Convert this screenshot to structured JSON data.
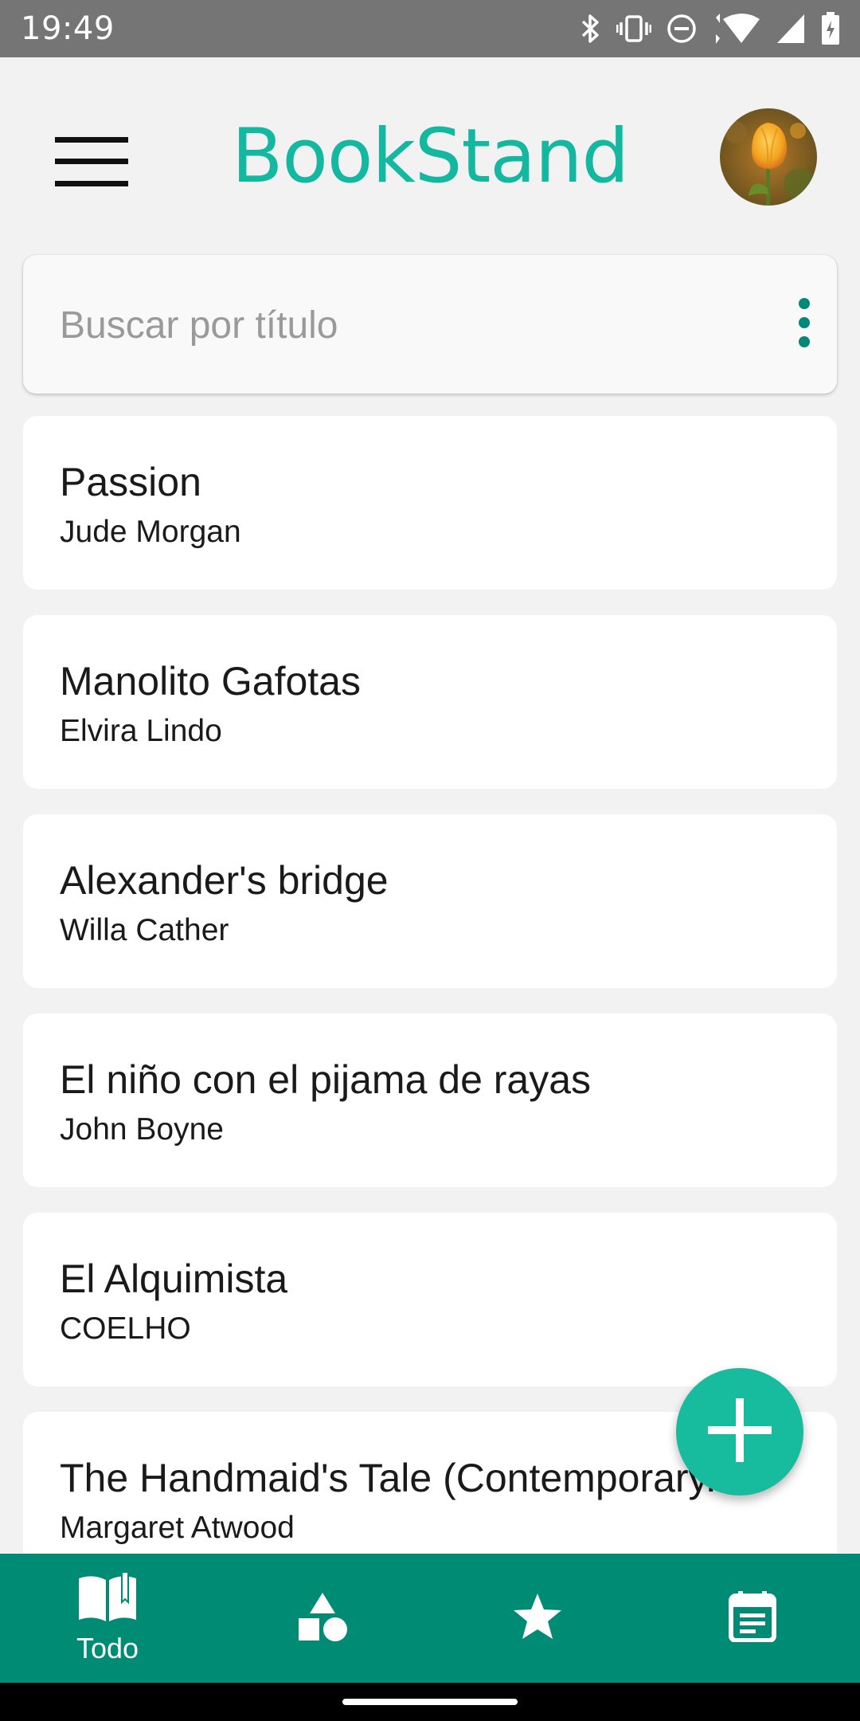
{
  "status_bar": {
    "time": "19:49",
    "icons": [
      "bluetooth-icon",
      "vibrate-icon",
      "do-not-disturb-icon",
      "wifi-icon",
      "signal-icon",
      "battery-icon"
    ]
  },
  "app_bar": {
    "title": "BookStand",
    "title_color": "#14b8a0",
    "menu_icon": "hamburger-menu-icon",
    "avatar_alt": "user-avatar"
  },
  "search": {
    "placeholder": "Buscar por título",
    "value": "",
    "more_icon": "more-vertical-icon"
  },
  "books": [
    {
      "title": "Passion",
      "author": "Jude Morgan"
    },
    {
      "title": "Manolito Gafotas",
      "author": "Elvira Lindo"
    },
    {
      "title": "Alexander's bridge",
      "author": "Willa Cather"
    },
    {
      "title": "El niño con el pijama de rayas",
      "author": "John Boyne"
    },
    {
      "title": "El Alquimista",
      "author": "COELHO"
    },
    {
      "title": "The Handmaid's Tale (Contemporary...",
      "author": "Margaret Atwood"
    }
  ],
  "fab": {
    "icon": "add-icon",
    "color": "#17bb9e"
  },
  "bottom_nav": {
    "color": "#008b74",
    "items": [
      {
        "icon": "book-open-icon",
        "label": "Todo",
        "selected": true
      },
      {
        "icon": "category-shapes-icon",
        "label": ""
      },
      {
        "icon": "star-icon",
        "label": ""
      },
      {
        "icon": "calendar-icon",
        "label": ""
      }
    ]
  }
}
